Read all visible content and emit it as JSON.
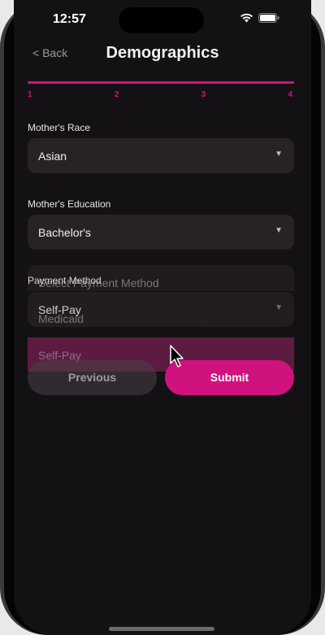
{
  "status": {
    "time": "12:57"
  },
  "nav": {
    "back_label": "< Back",
    "title": "Demographics"
  },
  "progress": {
    "current_step": 4,
    "total_steps": 4,
    "fraction": 1.0,
    "steps": [
      "1",
      "2",
      "3",
      "4"
    ]
  },
  "fields": {
    "mothers_race": {
      "label": "Mother's Race",
      "value": "Asian"
    },
    "mothers_education": {
      "label": "Mother's Education",
      "value": "Bachelor's"
    },
    "payment_method": {
      "label": "Payment Method",
      "value": "Self-Pay"
    }
  },
  "dropdown": {
    "options": [
      "Select Payment Method",
      "Medicaid",
      "Self-Pay"
    ],
    "highlighted": "Self-Pay"
  },
  "buttons": {
    "previous_label": "Previous",
    "submit_label": "Submit"
  },
  "colors": {
    "accent": "#d0127f",
    "background": "#141114",
    "field": "#282226"
  },
  "icons": {
    "caret": "▼"
  }
}
